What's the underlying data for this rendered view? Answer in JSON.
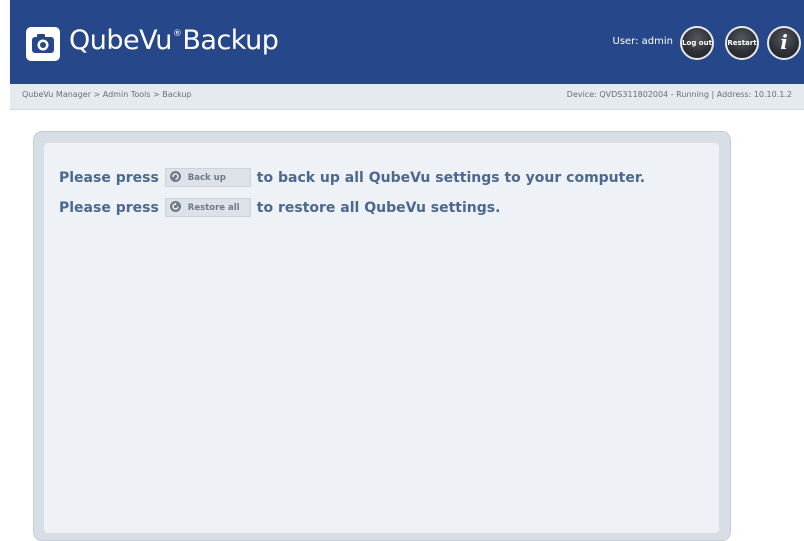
{
  "header": {
    "app_name": "QubeVu",
    "app_suffix": "Backup",
    "reg_mark": "®",
    "user_label": "User: admin",
    "logout_label": "Log out",
    "restart_label": "Restart",
    "info_label": "i"
  },
  "subbar": {
    "breadcrumb": "QubeVu Manager > Admin Tools > Backup",
    "device_info": "Device: QVDS311802004 - Running | Address: 10.10.1.2"
  },
  "content": {
    "line1_prefix": "Please press",
    "backup_button_label": "Back up",
    "line1_suffix": "to back up all QubeVu settings to your computer.",
    "line2_prefix": "Please press",
    "restore_button_label": "Restore all",
    "line2_suffix": "to restore all QubeVu settings."
  },
  "colors": {
    "header_bg": "#26488a",
    "text_blue": "#4a6890",
    "panel_bg": "#eef1f5"
  },
  "icons": {
    "logo": "camera-icon",
    "backup": "arrow-circle-icon",
    "restore": "restore-circle-icon"
  }
}
